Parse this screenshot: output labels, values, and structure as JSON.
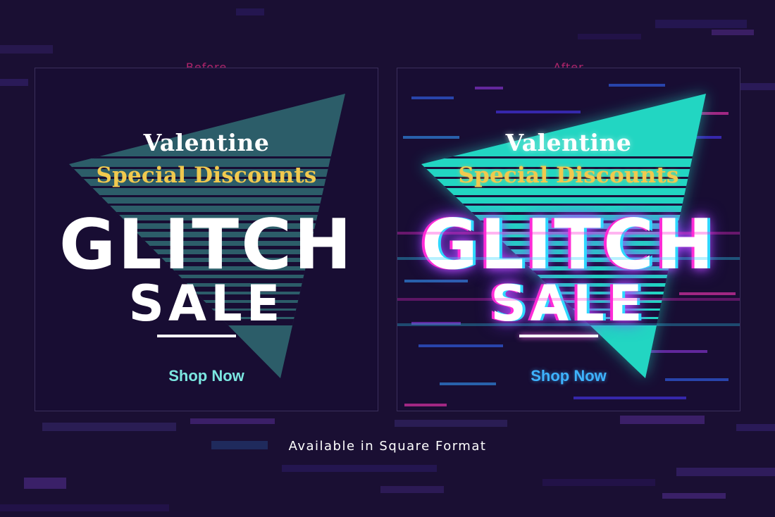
{
  "labels": {
    "before": "Before",
    "after": "After"
  },
  "poster": {
    "line1": "Valentine",
    "line2": "Special Discounts",
    "headline": "GLITCH",
    "subhead": "SALE",
    "cta": "Shop Now"
  },
  "footer": "Available in Square Format",
  "colors": {
    "background": "#1a0f33",
    "triangle_before": "#2c5d69",
    "triangle_after": "#22d6c2",
    "headline": "#ffffff",
    "special": "#f1c94e",
    "cta_before": "#7be6e0",
    "cta_after": "#3eb3ff",
    "label": "#b0246b"
  }
}
